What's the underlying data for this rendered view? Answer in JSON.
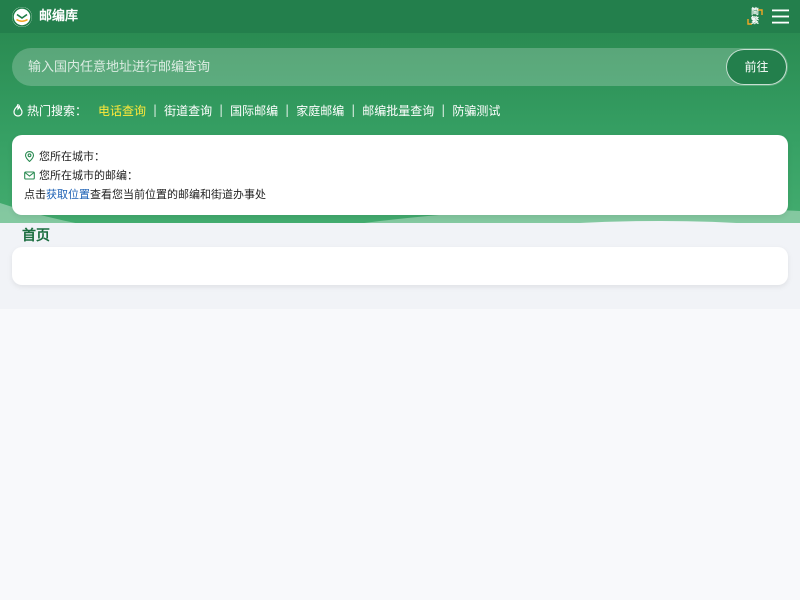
{
  "header": {
    "site_name": "邮编库",
    "lang_simplified": "简",
    "lang_traditional": "繁"
  },
  "search": {
    "placeholder": "输入国内任意地址进行邮编查询",
    "button_label": "前往"
  },
  "hot_search": {
    "label": "热门搜索：",
    "links": [
      "电话查询",
      "街道查询",
      "国际邮编",
      "家庭邮编",
      "邮编批量查询",
      "防骗测试"
    ],
    "separator": "|"
  },
  "location": {
    "city_label": "您所在城市：",
    "zip_label": "您所在城市的邮编：",
    "hint_prefix": "点击",
    "hint_link": "获取位置",
    "hint_suffix": "查看您当前位置的邮编和街道办事处"
  },
  "section": {
    "title": "首页"
  },
  "colors": {
    "header_bg": "#237f4c",
    "hero_bg": "#36a064",
    "hot_active": "#ffe83a",
    "link_blue": "#1a5fb4",
    "section_title": "#1b6d3f"
  }
}
